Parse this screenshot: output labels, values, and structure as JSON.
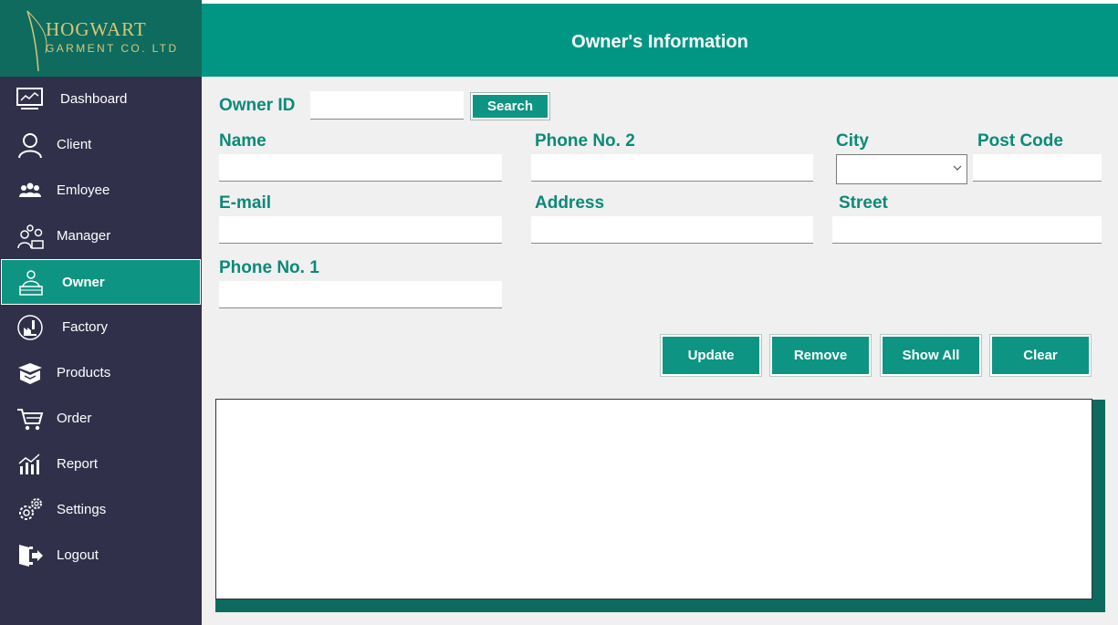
{
  "sidebar": {
    "logo": {
      "line1": "HOGWART",
      "line2": "GARMENT CO. LTD"
    },
    "items": [
      {
        "label": "Dashboard",
        "icon": "dashboard-icon"
      },
      {
        "label": "Client",
        "icon": "person-icon"
      },
      {
        "label": "Emloyee",
        "icon": "group-icon"
      },
      {
        "label": "Manager",
        "icon": "manager-icon"
      },
      {
        "label": "Owner",
        "icon": "owner-icon",
        "active": true
      },
      {
        "label": "Factory",
        "icon": "factory-icon"
      },
      {
        "label": "Products",
        "icon": "products-icon"
      },
      {
        "label": "Order",
        "icon": "cart-icon"
      },
      {
        "label": "Report",
        "icon": "report-icon"
      },
      {
        "label": "Settings",
        "icon": "gear-icon"
      },
      {
        "label": "Logout",
        "icon": "logout-icon"
      }
    ]
  },
  "header": {
    "title": "Owner's Information"
  },
  "form": {
    "owner_id_label": "Owner ID",
    "owner_id_value": "",
    "search_label": "Search",
    "name_label": "Name",
    "phone2_label": "Phone No. 2",
    "city_label": "City",
    "city_value": "",
    "postcode_label": "Post Code",
    "email_label": "E-mail",
    "address_label": "Address",
    "street_label": "Street",
    "phone1_label": "Phone No. 1"
  },
  "actions": {
    "update": "Update",
    "remove": "Remove",
    "show_all": "Show All",
    "clear": "Clear"
  },
  "colors": {
    "sidebar_bg": "#31304a",
    "accent": "#009684",
    "active_item": "#0e9482",
    "label_text": "#0b8a79",
    "logo_gold": "#d9c777"
  }
}
